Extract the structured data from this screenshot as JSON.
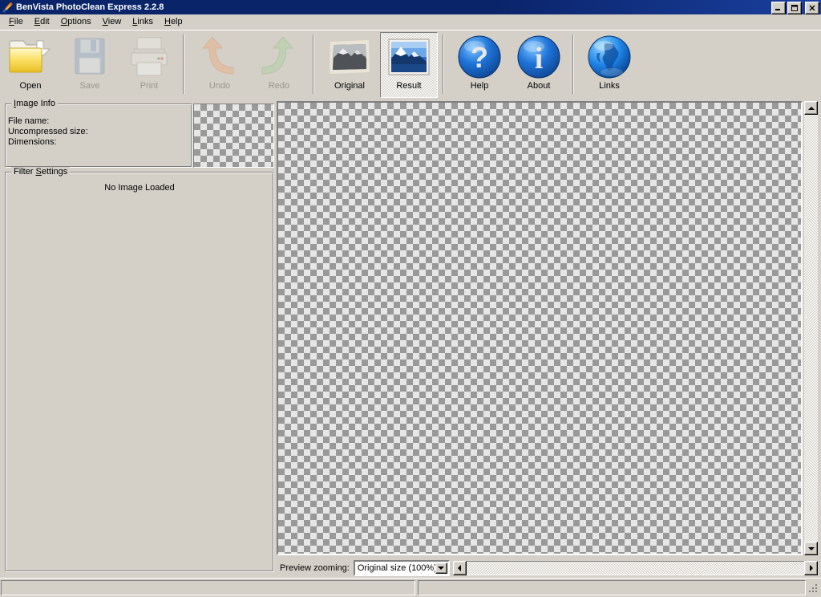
{
  "window": {
    "title": "BenVista PhotoClean Express 2.2.8",
    "icon": "brush-icon",
    "minimize_label": "_",
    "maximize_label": "□",
    "close_label": "✕"
  },
  "menubar": {
    "items": [
      {
        "label": "File",
        "accel": "F"
      },
      {
        "label": "Edit",
        "accel": "E"
      },
      {
        "label": "Options",
        "accel": "O"
      },
      {
        "label": "View",
        "accel": "V"
      },
      {
        "label": "Links",
        "accel": "L"
      },
      {
        "label": "Help",
        "accel": "H"
      }
    ]
  },
  "toolbar": {
    "buttons": [
      {
        "label": "Open",
        "icon": "open-folder-icon",
        "enabled": true,
        "pressed": false
      },
      {
        "label": "Save",
        "icon": "floppy-disk-icon",
        "enabled": false,
        "pressed": false
      },
      {
        "label": "Print",
        "icon": "printer-icon",
        "enabled": false,
        "pressed": false
      },
      {
        "label": "Undo",
        "icon": "undo-arrow-icon",
        "enabled": false,
        "pressed": false
      },
      {
        "label": "Redo",
        "icon": "redo-arrow-icon",
        "enabled": false,
        "pressed": false
      },
      {
        "label": "Original",
        "icon": "original-photo-icon",
        "enabled": true,
        "pressed": false
      },
      {
        "label": "Result",
        "icon": "result-photo-icon",
        "enabled": true,
        "pressed": true
      },
      {
        "label": "Help",
        "icon": "question-mark-icon",
        "enabled": true,
        "pressed": false
      },
      {
        "label": "About",
        "icon": "info-icon",
        "enabled": true,
        "pressed": false
      },
      {
        "label": "Links",
        "icon": "globe-icon",
        "enabled": true,
        "pressed": false
      }
    ]
  },
  "image_info": {
    "group_title": "Image Info",
    "group_title_accel": "I",
    "fields": [
      {
        "label": "File name:",
        "value": ""
      },
      {
        "label": "Uncompressed size:",
        "value": ""
      },
      {
        "label": "Dimensions:",
        "value": ""
      }
    ],
    "thumbnail_alt": "empty-thumbnail"
  },
  "filter_settings": {
    "group_title": "Filter Settings",
    "group_title_accel": "S",
    "message": "No Image Loaded"
  },
  "preview": {
    "zoom_label": "Preview zooming:",
    "zoom_value": "Original size (100%)",
    "zoom_options": [
      "Original size (100%)"
    ],
    "content": "empty-checkerboard"
  },
  "statusbar": {
    "pane1": "",
    "pane2": ""
  },
  "colors": {
    "titlebar_start": "#0a246a",
    "titlebar_end": "#1a3f9e",
    "face": "#d4d0c8",
    "shadow": "#808080",
    "highlight": "#ffffff",
    "disabled_text": "#9a968e",
    "checker_light": "#e6e6e6",
    "checker_dark": "#999999"
  }
}
